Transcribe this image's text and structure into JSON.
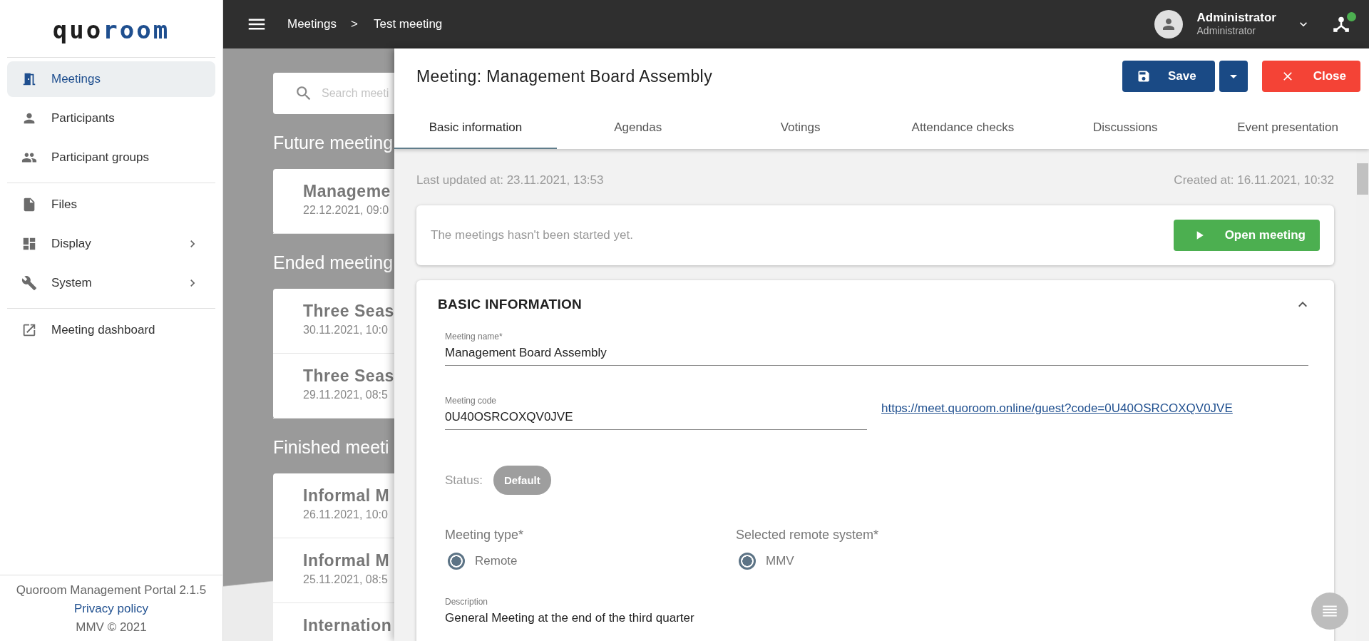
{
  "sidebar": {
    "logo": [
      {
        "text": "quo",
        "accent": false
      },
      {
        "text": "room",
        "accent": true
      }
    ],
    "groups": [
      [
        {
          "label": "Meetings",
          "selected": true,
          "submenu": false
        },
        {
          "label": "Participants",
          "selected": false,
          "submenu": false
        },
        {
          "label": "Participant groups",
          "selected": false,
          "submenu": false
        }
      ],
      [
        {
          "label": "Files",
          "selected": false,
          "submenu": false
        },
        {
          "label": "Display",
          "selected": false,
          "submenu": true
        },
        {
          "label": "System",
          "selected": false,
          "submenu": true
        }
      ],
      [
        {
          "label": "Meeting dashboard",
          "selected": false,
          "submenu": false
        }
      ]
    ],
    "footer": {
      "version": "Quoroom Management Portal 2.1.5",
      "link": "Privacy policy",
      "copyright": "MMV © 2021"
    }
  },
  "topbar": {
    "breadcrumb": [
      "Meetings",
      "Test meeting"
    ],
    "separator": ">",
    "user": {
      "name": "Administrator",
      "role": "Administrator"
    },
    "connection": {
      "online": true
    }
  },
  "meeting_list": {
    "search": {
      "placeholder": "Search meeti"
    },
    "sections": [
      {
        "title": "Future meeting",
        "items": [
          {
            "title": "Manageme",
            "date": "22.12.2021, 09:0"
          }
        ]
      },
      {
        "title": "Ended meeting",
        "items": [
          {
            "title": "Three Seas",
            "date": "30.11.2021, 10:0"
          },
          {
            "title": "Three Seas",
            "date": "29.11.2021, 08:5"
          }
        ]
      },
      {
        "title": "Finished meeti",
        "items": [
          {
            "title": "Informal M",
            "date": "26.11.2021, 10:0"
          },
          {
            "title": "Informal M",
            "date": "25.11.2021, 08:5"
          },
          {
            "title": "Internation"
          }
        ]
      }
    ]
  },
  "dialog": {
    "title": "Meeting: Management Board Assembly",
    "buttons": {
      "save": "Save",
      "close": "Close"
    },
    "tabs": [
      {
        "label": "Basic information",
        "selected": true
      },
      {
        "label": "Agendas",
        "selected": false
      },
      {
        "label": "Votings",
        "selected": false
      },
      {
        "label": "Attendance checks",
        "selected": false
      },
      {
        "label": "Discussions",
        "selected": false
      },
      {
        "label": "Event presentation",
        "selected": false
      }
    ],
    "last_updated": "Last updated at: 23.11.2021, 13:53",
    "created": "Created at: 16.11.2021, 10:32",
    "notice": {
      "text": "The meetings hasn't been started yet.",
      "button": "Open meeting"
    },
    "basic_information": {
      "title": "BASIC INFORMATION",
      "expanded": true,
      "meeting_name": {
        "label": "Meeting name*",
        "value": "Management Board Assembly"
      },
      "meeting_code": {
        "label": "Meeting code",
        "value": "0U40OSRCOXQV0JVE",
        "link": "https://meet.quoroom.online/guest?code=0U40OSRCOXQV0JVE"
      },
      "status": {
        "label": "Status:",
        "value": "Default"
      },
      "meeting_type": {
        "label": "Meeting type*",
        "options": [
          {
            "label": "Remote",
            "selected": true
          }
        ]
      },
      "remote_system": {
        "label": "Selected remote system*",
        "options": [
          {
            "label": "MMV",
            "selected": true
          }
        ]
      },
      "description": {
        "label": "Description",
        "value": "General Meeting at the end of the third quarter"
      }
    }
  }
}
